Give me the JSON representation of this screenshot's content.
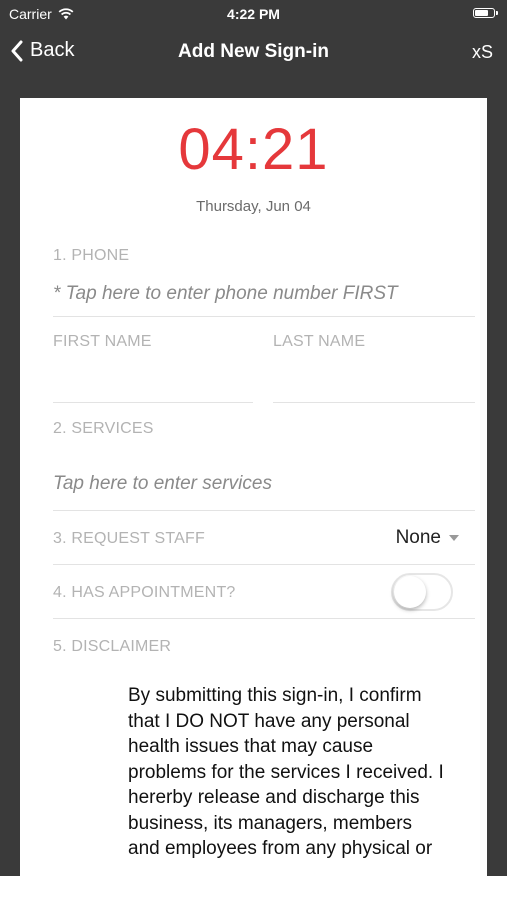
{
  "status_bar": {
    "carrier": "Carrier",
    "time": "4:22 PM"
  },
  "nav": {
    "back_label": "Back",
    "title": "Add New Sign-in",
    "right_label": "xS"
  },
  "clock": {
    "time": "04:21",
    "date": "Thursday, Jun 04"
  },
  "form": {
    "phone": {
      "label": "1. PHONE",
      "placeholder": "* Tap here to enter phone number FIRST"
    },
    "first_name": {
      "label": "FIRST NAME",
      "value": ""
    },
    "last_name": {
      "label": "LAST NAME",
      "value": ""
    },
    "services": {
      "label": "2. SERVICES",
      "placeholder": "Tap here to enter services"
    },
    "request_staff": {
      "label": "3. REQUEST STAFF",
      "value": "None"
    },
    "appointment": {
      "label": "4. HAS APPOINTMENT?",
      "on": false
    },
    "disclaimer": {
      "label": "5. DISCLAIMER",
      "text": "By submitting this sign-in, I confirm that I DO NOT have any personal health issues that may cause problems for the services I received. I hererby release and discharge this business, its managers, members and employees from any physical or"
    }
  },
  "colors": {
    "accent": "#e5383b",
    "nav_background": "#3a3a3a"
  },
  "icons": {
    "back": "chevron-left-icon",
    "wifi": "wifi-icon",
    "battery": "battery-icon",
    "dropdown": "caret-down-icon"
  }
}
